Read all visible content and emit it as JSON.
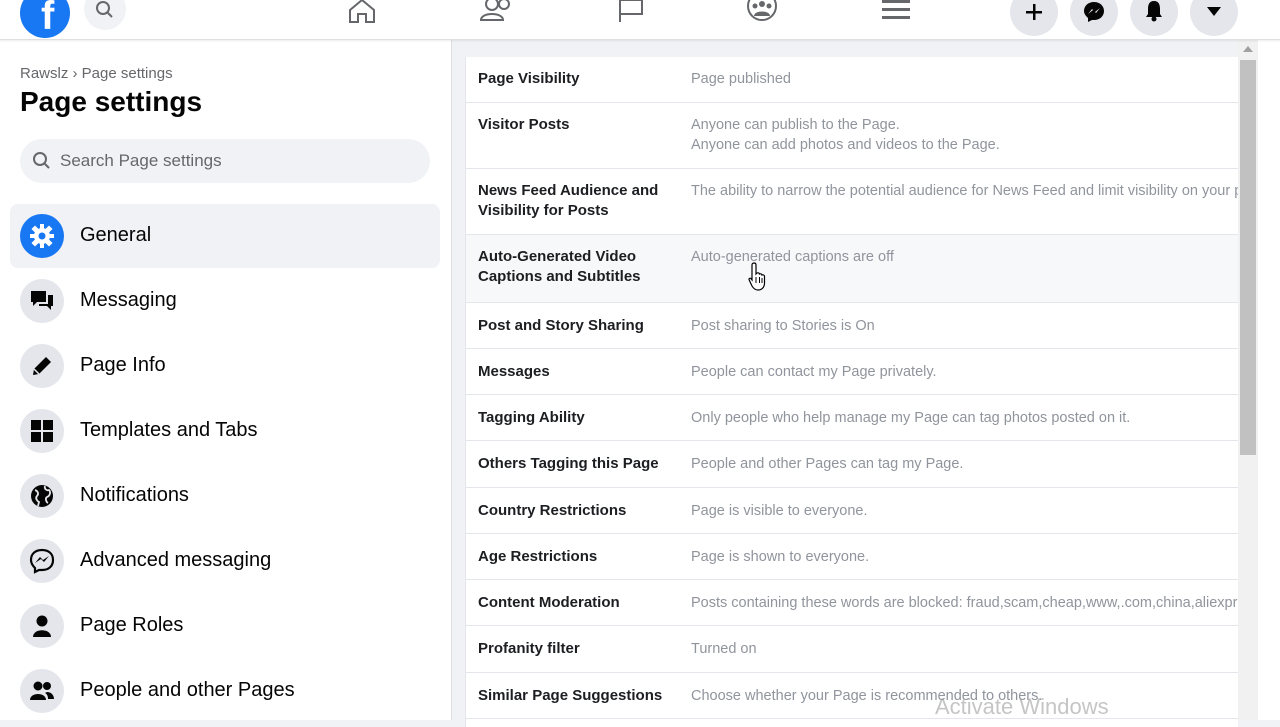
{
  "topbar": {
    "logo_letter": "f",
    "icons": [
      "facebook-logo",
      "search-icon",
      "home-icon",
      "friends-icon",
      "pages-flag-icon",
      "groups-icon",
      "menu-icon",
      "plus-icon",
      "messenger-icon",
      "bell-icon",
      "caret-down-icon"
    ]
  },
  "sidebar": {
    "breadcrumb": "Rawslz › Page settings",
    "title": "Page settings",
    "search_placeholder": "Search Page settings",
    "items": [
      {
        "label": "General",
        "icon": "gear-icon",
        "active": true
      },
      {
        "label": "Messaging",
        "icon": "chat-bubbles-icon"
      },
      {
        "label": "Page Info",
        "icon": "pencil-icon"
      },
      {
        "label": "Templates and Tabs",
        "icon": "grid-icon"
      },
      {
        "label": "Notifications",
        "icon": "globe-icon"
      },
      {
        "label": "Advanced messaging",
        "icon": "messenger-icon"
      },
      {
        "label": "Page Roles",
        "icon": "person-icon"
      },
      {
        "label": "People and other Pages",
        "icon": "people-icon"
      }
    ]
  },
  "settings": [
    {
      "label": "Page Visibility",
      "value": "Page published"
    },
    {
      "label": "Visitor Posts",
      "value": "Anyone can publish to the Page.",
      "value2": "Anyone can add photos and videos to the Page."
    },
    {
      "label": "News Feed Audience and Visibility for Posts",
      "value": "The ability to narrow the potential audience for News Feed and limit visibility on your posts is turned off."
    },
    {
      "label": "Auto-Generated Video Captions and Subtitles",
      "value": "Auto-generated captions are off"
    },
    {
      "label": "Post and Story Sharing",
      "value": "Post sharing to Stories is On"
    },
    {
      "label": "Messages",
      "value": "People can contact my Page privately."
    },
    {
      "label": "Tagging Ability",
      "value": "Only people who help manage my Page can tag photos posted on it."
    },
    {
      "label": "Others Tagging this Page",
      "value": "People and other Pages can tag my Page."
    },
    {
      "label": "Country Restrictions",
      "value": "Page is visible to everyone."
    },
    {
      "label": "Age Restrictions",
      "value": "Page is shown to everyone."
    },
    {
      "label": "Content Moderation",
      "value": "Posts containing these words are blocked: fraud,scam,cheap,www,.com,china,aliexpress"
    },
    {
      "label": "Profanity filter",
      "value": "Turned on"
    },
    {
      "label": "Similar Page Suggestions",
      "value": "Choose whether your Page is recommended to others."
    }
  ],
  "watermark": "Activate Windows",
  "colors": {
    "accent": "#1877f2",
    "text": "#050505",
    "muted": "#65676b"
  }
}
